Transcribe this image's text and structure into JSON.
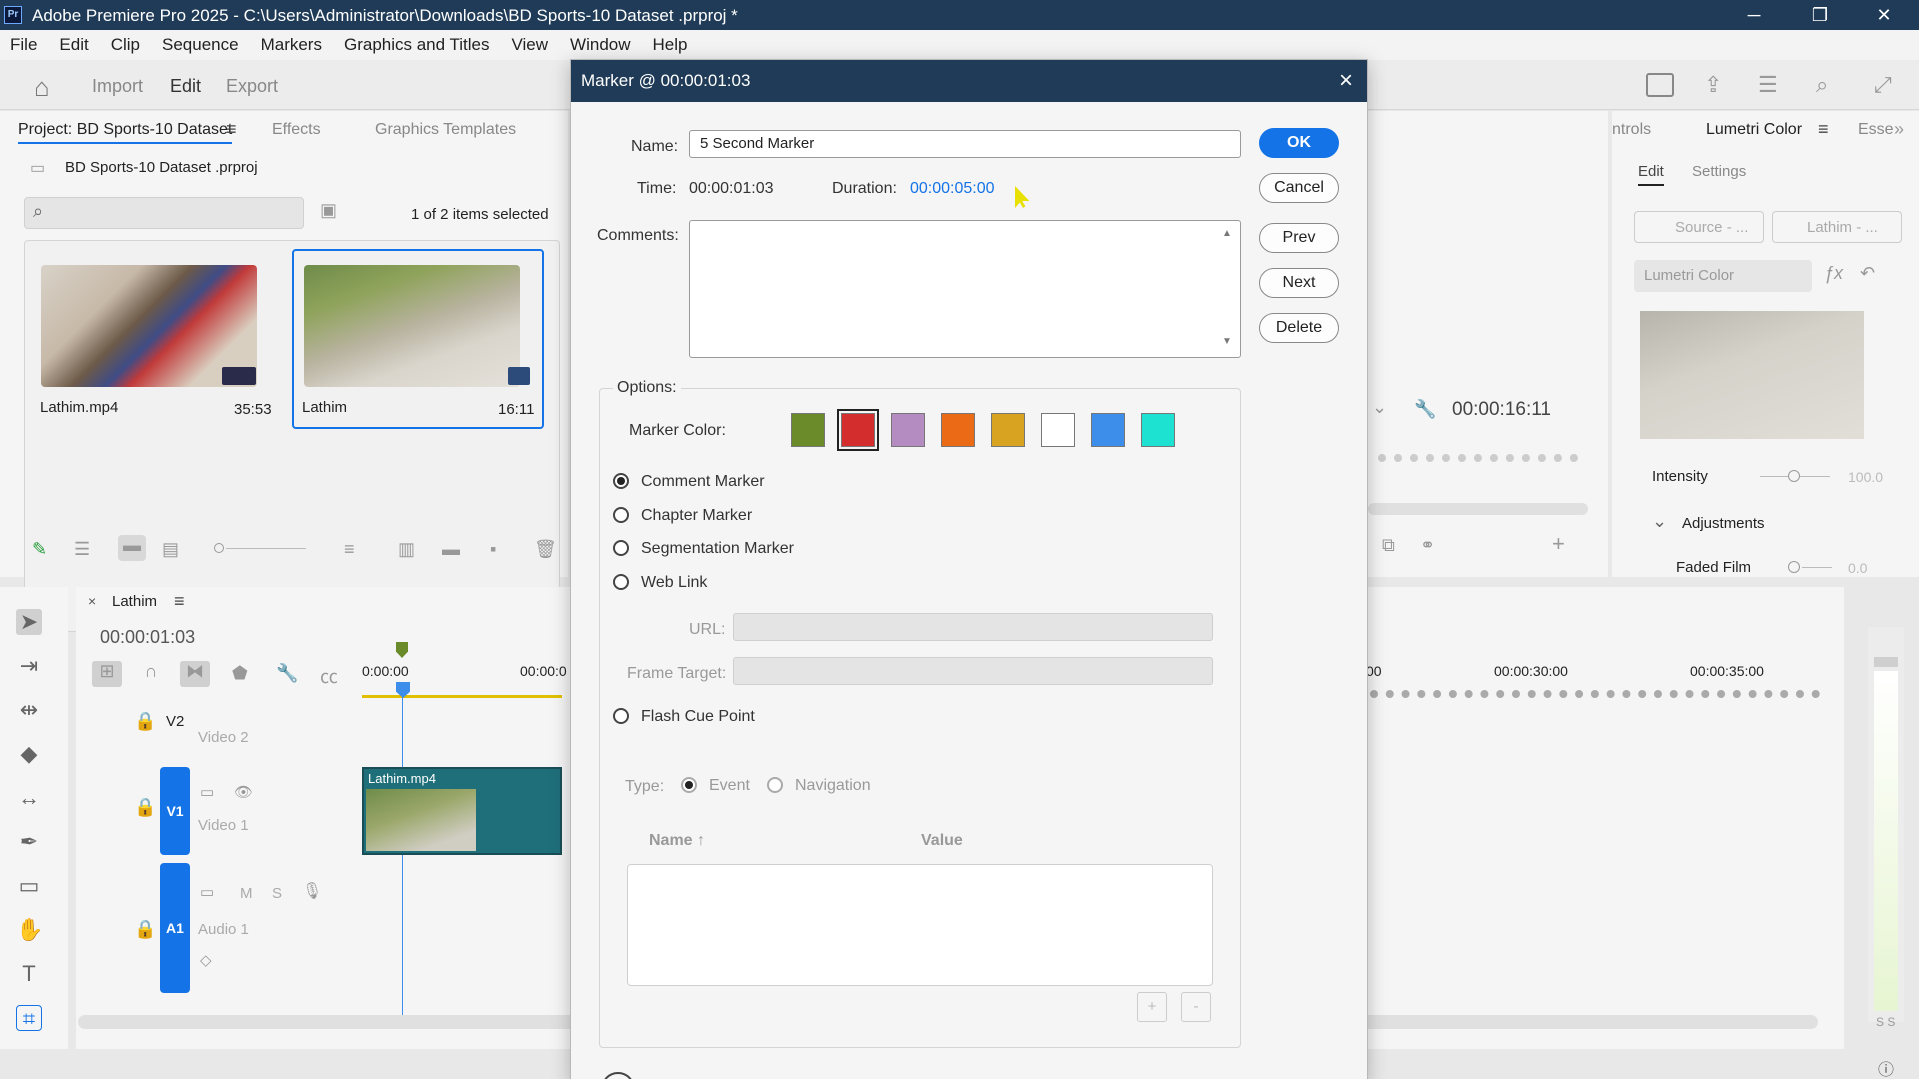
{
  "window": {
    "app_icon": "Pr",
    "title": "Adobe Premiere Pro 2025 - C:\\Users\\Administrator\\Downloads\\BD Sports-10 Dataset .prproj *",
    "minimize": "─",
    "restore": "❐",
    "close": "✕"
  },
  "menu": [
    "File",
    "Edit",
    "Clip",
    "Sequence",
    "Markers",
    "Graphics and Titles",
    "View",
    "Window",
    "Help"
  ],
  "workspace": {
    "import": "Import",
    "edit": "Edit",
    "export": "Export"
  },
  "project_panel": {
    "tabs": [
      "Project: BD Sports-10 Dataset",
      "Effects",
      "Graphics Templates"
    ],
    "project_file": "BD Sports-10 Dataset .prproj",
    "selection_status": "1 of 2 items selected",
    "items": [
      {
        "name": "Lathim.mp4",
        "duration": "35:53"
      },
      {
        "name": "Lathim",
        "duration": "16:11"
      }
    ]
  },
  "timeline": {
    "sequence_name": "Lathim",
    "timecode": "00:00:01:03",
    "ruler": [
      "0:00:00",
      "00:00:0",
      "00",
      "00:00:30:00",
      "00:00:35:00"
    ],
    "tracks": [
      {
        "id": "V2",
        "name": "Video 2"
      },
      {
        "id": "V1",
        "name": "Video 1"
      },
      {
        "id": "A1",
        "name": "Audio 1"
      }
    ],
    "audio_toggles": {
      "mute": "M",
      "solo": "S"
    },
    "clip_name": "Lathim.mp4",
    "meter_labels": "S S"
  },
  "program_monitor": {
    "timecode": "00:00:16:11"
  },
  "lumetri": {
    "tabs": [
      "ntrols",
      "Lumetri Color",
      "Esse"
    ],
    "subtabs": {
      "edit": "Edit",
      "settings": "Settings"
    },
    "source_dropdown": "Source - ...",
    "clip_dropdown": "Lathim - ...",
    "effect_dropdown": "Lumetri Color",
    "intensity_label": "Intensity",
    "intensity_value": "100.0",
    "adjustments": "Adjustments",
    "faded_film_label": "Faded Film",
    "faded_film_value": "0.0"
  },
  "dialog": {
    "title": "Marker @ 00:00:01:03",
    "name_label": "Name:",
    "name_value": "5 Second Marker",
    "time_label": "Time:",
    "time_value": "00:00:01:03",
    "duration_label": "Duration:",
    "duration_value": "00:00:05:00",
    "comments_label": "Comments:",
    "comments_value": "",
    "buttons": {
      "ok": "OK",
      "cancel": "Cancel",
      "prev": "Prev",
      "next": "Next",
      "delete": "Delete"
    },
    "options_label": "Options:",
    "marker_color_label": "Marker Color:",
    "marker_colors": [
      "#6b8a2a",
      "#d42d2d",
      "#b58cc2",
      "#ea6a16",
      "#d8a321",
      "#ffffff",
      "#3d8dea",
      "#1de2d2"
    ],
    "selected_color_index": 1,
    "marker_types": [
      "Comment Marker",
      "Chapter Marker",
      "Segmentation Marker",
      "Web Link"
    ],
    "selected_marker_type": "Comment Marker",
    "url_label": "URL:",
    "frame_target_label": "Frame Target:",
    "flash_cue_label": "Flash Cue Point",
    "type_label": "Type:",
    "type_options": [
      "Event",
      "Navigation"
    ],
    "table_headers": {
      "name": "Name ↑",
      "value": "Value"
    },
    "add": "+",
    "remove": "-"
  }
}
